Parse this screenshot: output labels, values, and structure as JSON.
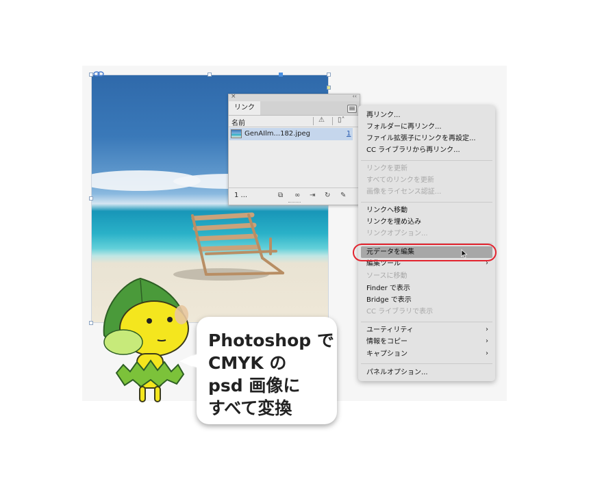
{
  "links_panel": {
    "tab_label": "リンク",
    "column_name": "名前",
    "link_filename": "GenAIlm...182.jpeg",
    "link_page": "1",
    "count_label": "1 ..."
  },
  "flyout_menu": {
    "relink": "再リンク...",
    "relink_folder": "フォルダーに再リンク...",
    "relink_extension": "ファイル拡張子にリンクを再設定...",
    "relink_cc": "CC ライブラリから再リンク...",
    "update_link": "リンクを更新",
    "update_all_links": "すべてのリンクを更新",
    "license_image": "画像をライセンス認証...",
    "go_to_link": "リンクへ移動",
    "embed_link": "リンクを埋め込み",
    "link_options": "リンクオプション...",
    "edit_original": "元データを編集",
    "edit_with": "編集ツール",
    "go_to_source": "ソースに移動",
    "reveal_finder": "Finder で表示",
    "reveal_bridge": "Bridge で表示",
    "reveal_cc": "CC ライブラリで表示",
    "utilities": "ユーティリティ",
    "copy_info": "情報をコピー",
    "captions": "キャプション",
    "panel_options": "パネルオプション..."
  },
  "callout": {
    "line1": "Photoshop で",
    "line2": "CMYK の",
    "line3": "psd 画像に",
    "line4": "すべて変換"
  },
  "colors": {
    "highlight_ring": "#e2232e",
    "selection_row": "#c5d6ec",
    "mascot_leaf": "#4a9a3a",
    "mascot_face": "#f4e61e"
  }
}
